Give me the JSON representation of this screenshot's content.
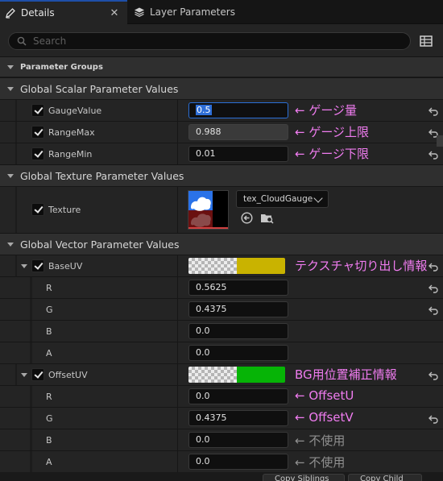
{
  "tabs": [
    {
      "label": "Details",
      "icon": "pencil-icon",
      "active": true
    },
    {
      "label": "Layer Parameters",
      "icon": "layers-icon",
      "active": false
    }
  ],
  "search": {
    "placeholder": "Search",
    "value": ""
  },
  "sections": {
    "parameter_groups": "Parameter Groups",
    "scalar": "Global Scalar Parameter Values",
    "texture": "Global Texture Parameter Values",
    "vector": "Global Vector Parameter Values"
  },
  "scalar_params": [
    {
      "name": "GaugeValue",
      "value": "0.5",
      "enabled": true,
      "note": "← ゲージ量"
    },
    {
      "name": "RangeMax",
      "value": "0.988",
      "enabled": true,
      "note": "← ゲージ上限"
    },
    {
      "name": "RangeMin",
      "value": "0.01",
      "enabled": true,
      "note": "← ゲージ下限"
    }
  ],
  "texture_param": {
    "name": "Texture",
    "enabled": true,
    "asset": "tex_CloudGauge"
  },
  "vector_params": [
    {
      "name": "BaseUV",
      "enabled": true,
      "color": "#c9b300",
      "note": "テクスチャ切り出し情報",
      "channels": [
        {
          "name": "R",
          "value": "0.5625",
          "note": ""
        },
        {
          "name": "G",
          "value": "0.4375",
          "note": ""
        },
        {
          "name": "B",
          "value": "0.0",
          "note": ""
        },
        {
          "name": "A",
          "value": "0.0",
          "note": ""
        }
      ]
    },
    {
      "name": "OffsetUV",
      "enabled": true,
      "color": "#06b406",
      "note": "BG用位置補正情報",
      "channels": [
        {
          "name": "R",
          "value": "0.0",
          "note": "← OffsetU"
        },
        {
          "name": "G",
          "value": "0.4375",
          "note": "← OffsetV"
        },
        {
          "name": "B",
          "value": "0.0",
          "note": "← 不使用"
        },
        {
          "name": "A",
          "value": "0.0",
          "note": "← 不使用"
        }
      ]
    }
  ],
  "bottom_buttons": [
    "Copy Siblings",
    "Copy Child"
  ],
  "colors": {
    "note_pink": "#f07cf0",
    "note_gray": "#909090",
    "focus_blue": "#2b6fd6"
  }
}
